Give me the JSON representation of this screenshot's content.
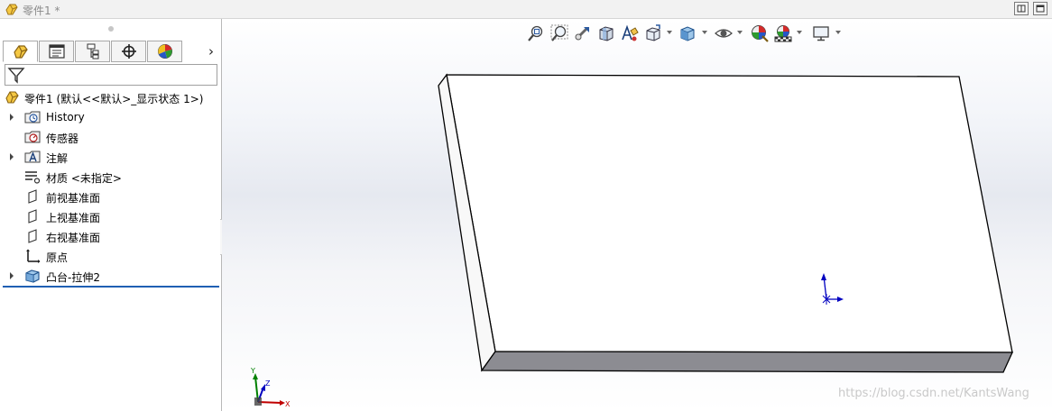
{
  "window": {
    "title": "零件1 *"
  },
  "panel": {
    "tabs": [
      {
        "icon": "feature-manager-icon",
        "active": true
      },
      {
        "icon": "property-manager-icon",
        "active": false
      },
      {
        "icon": "configuration-manager-icon",
        "active": false
      },
      {
        "icon": "dimxpert-manager-icon",
        "active": false
      },
      {
        "icon": "display-manager-icon",
        "active": false
      }
    ],
    "more_label": "›",
    "tree": {
      "root": "零件1  (默认<<默认>_显示状态 1>)",
      "items": [
        {
          "label": "History",
          "expandable": true,
          "icon": "history-folder-icon"
        },
        {
          "label": "传感器",
          "expandable": false,
          "icon": "sensor-folder-icon"
        },
        {
          "label": "注解",
          "expandable": true,
          "icon": "annotation-folder-icon"
        },
        {
          "label": "材质 <未指定>",
          "expandable": false,
          "icon": "material-icon"
        },
        {
          "label": "前视基准面",
          "expandable": false,
          "icon": "plane-icon"
        },
        {
          "label": "上视基准面",
          "expandable": false,
          "icon": "plane-icon"
        },
        {
          "label": "右视基准面",
          "expandable": false,
          "icon": "plane-icon"
        },
        {
          "label": "原点",
          "expandable": false,
          "icon": "origin-icon"
        },
        {
          "label": "凸台-拉伸2",
          "expandable": true,
          "icon": "boss-extrude-icon"
        }
      ]
    }
  },
  "viewport": {
    "toolbar": [
      "zoom-to-fit-icon",
      "zoom-to-area-icon",
      "previous-view-icon",
      "section-view-icon",
      "dynamic-annotation-view-icon",
      "view-orientation-icon",
      "display-style-icon",
      "hide-show-items-icon",
      "edit-appearance-icon",
      "apply-scene-icon",
      "view-settings-icon"
    ],
    "triad_labels": {
      "x": "X",
      "y": "Y",
      "z": "Z"
    },
    "watermark": "https://blog.csdn.net/KantsWang"
  },
  "colors": {
    "selection": "#1f5fb3",
    "part_bottom_face": "#8c8c92",
    "triad_x": "#c00000",
    "triad_y": "#008000",
    "triad_z": "#0000c0"
  }
}
